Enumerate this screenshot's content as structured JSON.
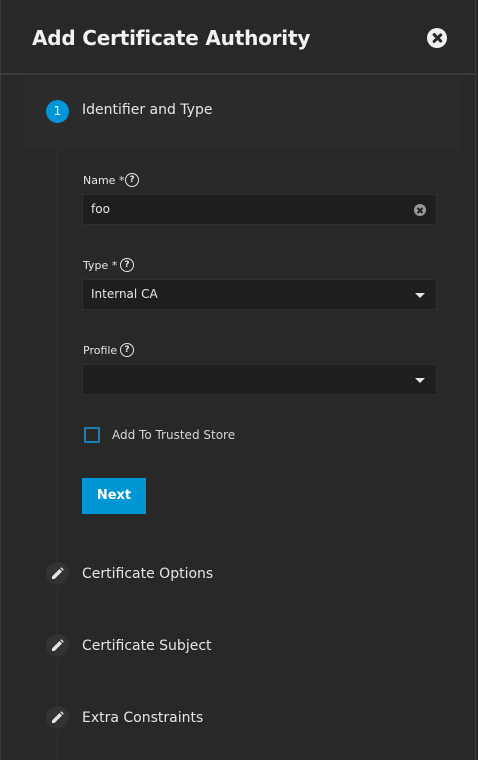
{
  "dialog": {
    "title": "Add Certificate Authority"
  },
  "steps": [
    {
      "number": "1",
      "label": "Identifier and Type",
      "state": "active"
    },
    {
      "label": "Certificate Options",
      "state": "editable",
      "icon": "pencil-icon"
    },
    {
      "label": "Certificate Subject",
      "state": "editable",
      "icon": "pencil-icon"
    },
    {
      "label": "Extra Constraints",
      "state": "editable",
      "icon": "pencil-icon"
    }
  ],
  "form": {
    "name": {
      "label": "Name",
      "required_mark": "*",
      "value": "foo"
    },
    "type": {
      "label": "Type",
      "required_mark": "*",
      "value": "Internal CA"
    },
    "profile": {
      "label": "Profile",
      "value": ""
    },
    "trusted_store": {
      "label": "Add To Trusted Store",
      "checked": false
    },
    "next_label": "Next"
  },
  "colors": {
    "accent": "#0095d5",
    "background": "#282828",
    "input_bg": "#1e1e1e"
  }
}
